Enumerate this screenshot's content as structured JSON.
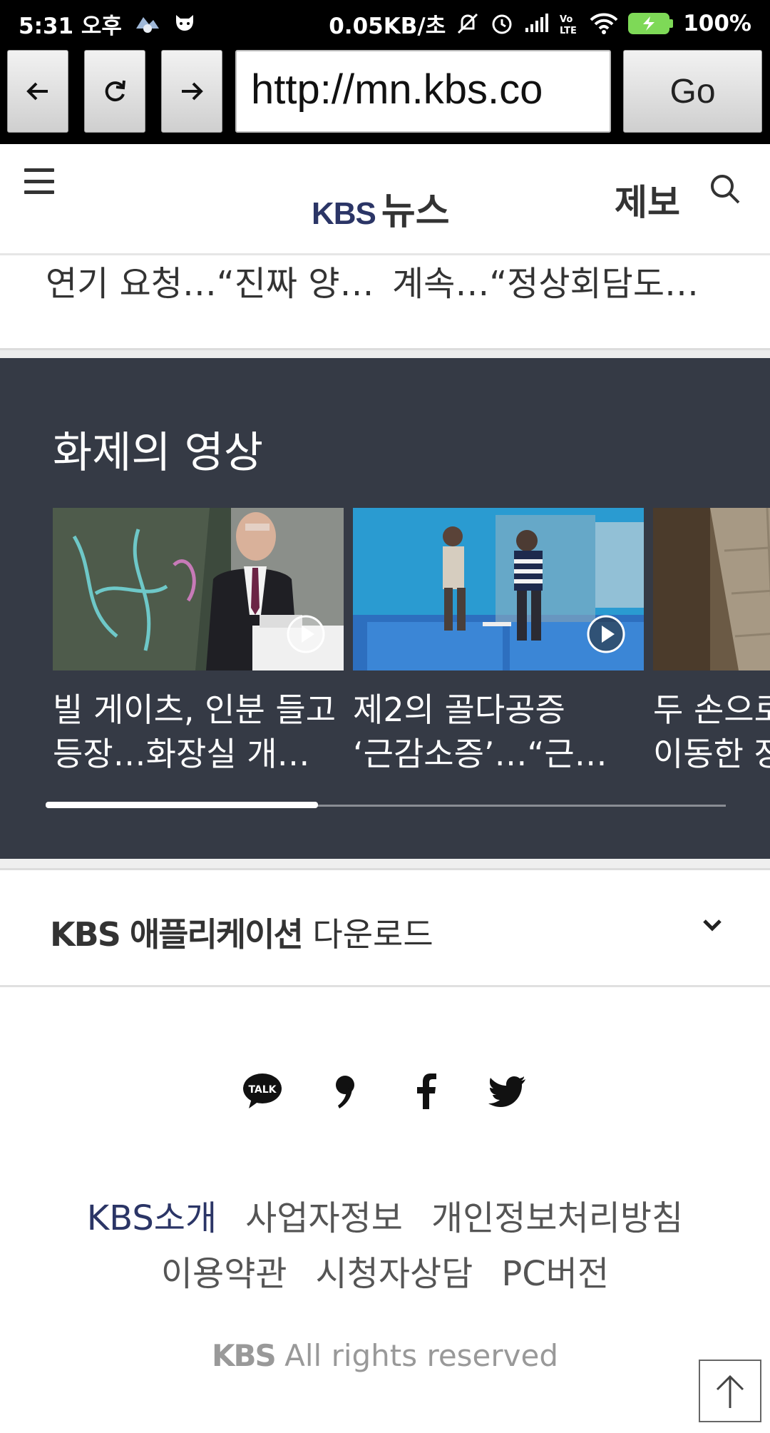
{
  "status_bar": {
    "time": "5:31 오후",
    "network_speed": "0.05KB/초",
    "battery": "100%",
    "icons": [
      "kbs-app-icon",
      "cat-icon",
      "mute-icon",
      "alarm-icon",
      "signal-icon",
      "volte-icon",
      "wifi-icon",
      "battery-charging-icon"
    ],
    "battery_color": "#7ed957"
  },
  "browser": {
    "back_label": "←",
    "reload_label": "↻",
    "forward_label": "→",
    "url": "http://mn.kbs.co",
    "go_label": "Go"
  },
  "header": {
    "logo_kbs": "KBS",
    "logo_news": "뉴스",
    "report_label": "제보",
    "brand_color": "#2b3566"
  },
  "article_row": {
    "items": [
      "연기 요청…“진짜 양…",
      "계속…“정상회담도…"
    ]
  },
  "video_section": {
    "title": "화제의 영상",
    "background": "#353a45",
    "cards": [
      {
        "caption_line1": "빌 게이츠, 인분 들고",
        "caption_line2": "등장…화장실 개…"
      },
      {
        "caption_line1": "제2의 골다공증",
        "caption_line2": "‘근감소증’…“근…"
      },
      {
        "caption_line1": "두 손으로",
        "caption_line2": "이동한 장"
      }
    ],
    "scroll_progress": 0.4
  },
  "app_download": {
    "bold_label": "KBS 애플리케이션",
    "label": " 다운로드"
  },
  "social": {
    "icons": [
      "kakaotalk-icon",
      "kakaostory-icon",
      "facebook-icon",
      "twitter-icon"
    ],
    "talk_text": "TALK"
  },
  "footer": {
    "links_row1": [
      "KBS소개",
      "사업자정보",
      "개인정보처리방침"
    ],
    "links_row2": [
      "이용약관",
      "시청자상담",
      "PC버전"
    ],
    "copyright_bold": "KBS",
    "copyright_text": " All rights reserved"
  }
}
